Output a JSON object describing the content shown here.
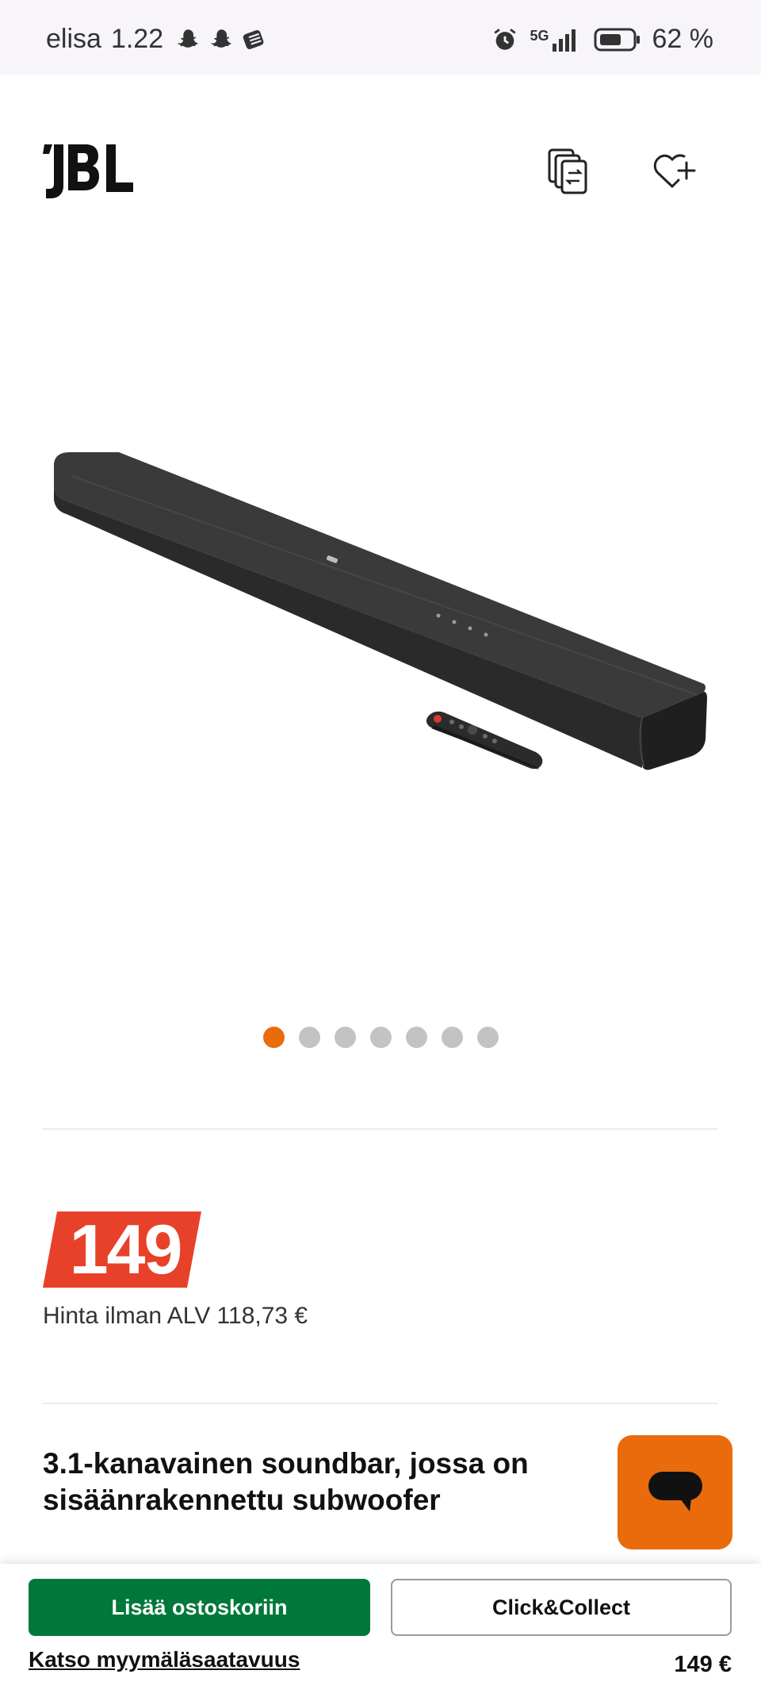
{
  "status_bar": {
    "carrier": "elisa",
    "time": "1.22",
    "network": "5G",
    "battery": "62 %",
    "icons": [
      "snapchat-icon",
      "snapchat-icon",
      "stack-icon",
      "alarm-icon",
      "signal-icon",
      "battery-icon"
    ]
  },
  "header": {
    "logo_alt": "JBL",
    "compare_icon": "compare-icon",
    "wishlist_icon": "heart-plus-icon"
  },
  "gallery": {
    "slide_count": 7,
    "active_index": 0,
    "active_color": "#ea6b0c",
    "inactive_color": "#c3c3c3"
  },
  "price": {
    "amount": "149",
    "vat_note": "Hinta ilman ALV 118,73 €",
    "tag_color": "#e8412a"
  },
  "product": {
    "title": "3.1-kanavainen soundbar, jossa on sisäänrakennettu subwoofer"
  },
  "chat": {
    "icon": "chat-bubble-icon",
    "color": "#ea6b0c"
  },
  "bottom_bar": {
    "add_to_cart": "Lisää ostoskoriin",
    "click_collect": "Click&Collect",
    "store_availability": "Katso myymäläsaatavuus",
    "price": "149 €",
    "cart_color": "#00783a"
  }
}
